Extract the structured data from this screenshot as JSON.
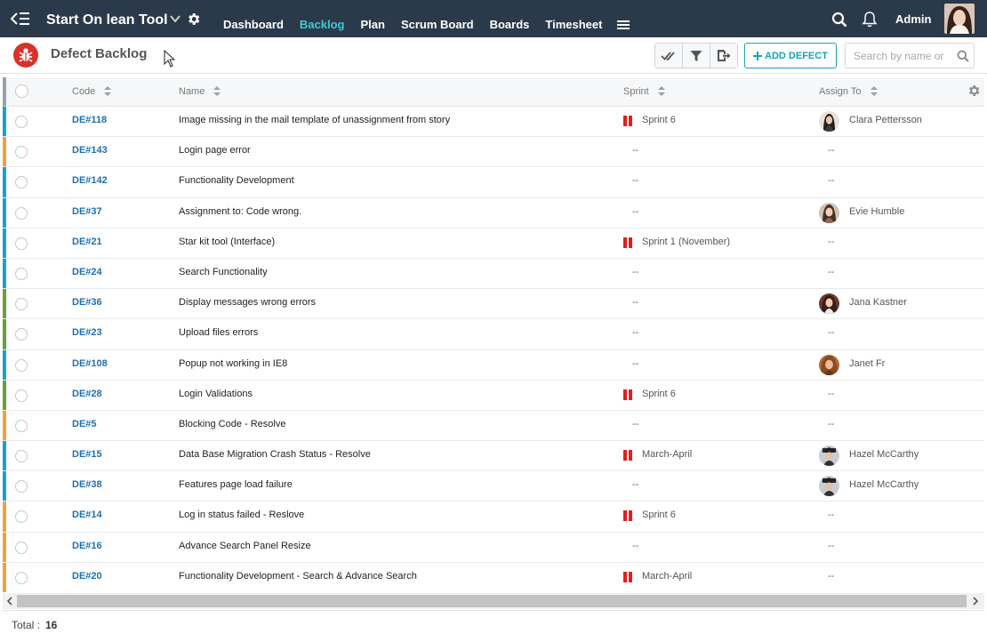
{
  "app": {
    "title": "Start On lean Tool",
    "admin_label": "Admin"
  },
  "nav": [
    {
      "label": "Dashboard",
      "active": false
    },
    {
      "label": "Backlog",
      "active": true
    },
    {
      "label": "Plan",
      "active": false
    },
    {
      "label": "Scrum Board",
      "active": false
    },
    {
      "label": "Boards",
      "active": false
    },
    {
      "label": "Timesheet",
      "active": false
    }
  ],
  "page": {
    "title": "Defect Backlog",
    "add_button": "ADD DEFECT",
    "search_placeholder": "Search by name or"
  },
  "columns": {
    "code": "Code",
    "name": "Name",
    "sprint": "Sprint",
    "assign": "Assign To"
  },
  "colors": {
    "accent": "#17a2b8",
    "nav_bg": "#2b3a4a",
    "active_nav": "#3fc9d3",
    "link": "#1f6fb0",
    "sprint_flag": "#e02020",
    "bar_blue": "#1aa3c9",
    "bar_orange": "#f0a23c",
    "bar_green": "#6a9e3d"
  },
  "rows": [
    {
      "code": "DE#118",
      "name": "Image missing in the mail template of unassignment from story",
      "sprint": "Sprint 6",
      "assignee": "Clara Pettersson",
      "bar": "blue",
      "avatar": "a1"
    },
    {
      "code": "DE#143",
      "name": "Login page error",
      "sprint": "--",
      "assignee": "--",
      "bar": "orange",
      "avatar": ""
    },
    {
      "code": "DE#142",
      "name": "Functionality Development",
      "sprint": "--",
      "assignee": "--",
      "bar": "blue",
      "avatar": ""
    },
    {
      "code": "DE#37",
      "name": "Assignment to: Code wrong.",
      "sprint": "--",
      "assignee": "Evie Humble",
      "bar": "blue",
      "avatar": "a2"
    },
    {
      "code": "DE#21",
      "name": "Star kit tool (Interface)",
      "sprint": "Sprint 1 (November)",
      "assignee": "--",
      "bar": "blue",
      "avatar": ""
    },
    {
      "code": "DE#24",
      "name": "Search Functionality",
      "sprint": "--",
      "assignee": "--",
      "bar": "blue",
      "avatar": ""
    },
    {
      "code": "DE#36",
      "name": "Display messages wrong errors",
      "sprint": "--",
      "assignee": "Jana Kastner",
      "bar": "green",
      "avatar": "a3"
    },
    {
      "code": "DE#23",
      "name": "Upload files errors",
      "sprint": "--",
      "assignee": "--",
      "bar": "green",
      "avatar": ""
    },
    {
      "code": "DE#108",
      "name": "Popup not working in IE8",
      "sprint": "--",
      "assignee": "Janet Fr",
      "bar": "blue",
      "avatar": "a4"
    },
    {
      "code": "DE#28",
      "name": "Login Validations",
      "sprint": "Sprint 6",
      "assignee": "--",
      "bar": "green",
      "avatar": ""
    },
    {
      "code": "DE#5",
      "name": "Blocking Code - Resolve",
      "sprint": "--",
      "assignee": "--",
      "bar": "orange",
      "avatar": ""
    },
    {
      "code": "DE#15",
      "name": "Data Base Migration Crash Status - Resolve",
      "sprint": "March-April",
      "assignee": "Hazel McCarthy",
      "bar": "blue",
      "avatar": "a5"
    },
    {
      "code": "DE#38",
      "name": "Features page load failure",
      "sprint": "--",
      "assignee": "Hazel McCarthy",
      "bar": "blue",
      "avatar": "a5"
    },
    {
      "code": "DE#14",
      "name": "Log in status failed - Reslove",
      "sprint": "Sprint 6",
      "assignee": "--",
      "bar": "orange",
      "avatar": ""
    },
    {
      "code": "DE#16",
      "name": "Advance Search Panel Resize",
      "sprint": "--",
      "assignee": "--",
      "bar": "orange",
      "avatar": ""
    },
    {
      "code": "DE#20",
      "name": "Functionality Development - Search & Advance Search",
      "sprint": "March-April",
      "assignee": "--",
      "bar": "orange",
      "avatar": ""
    }
  ],
  "footer": {
    "total_label": "Total :",
    "total_value": "16"
  }
}
